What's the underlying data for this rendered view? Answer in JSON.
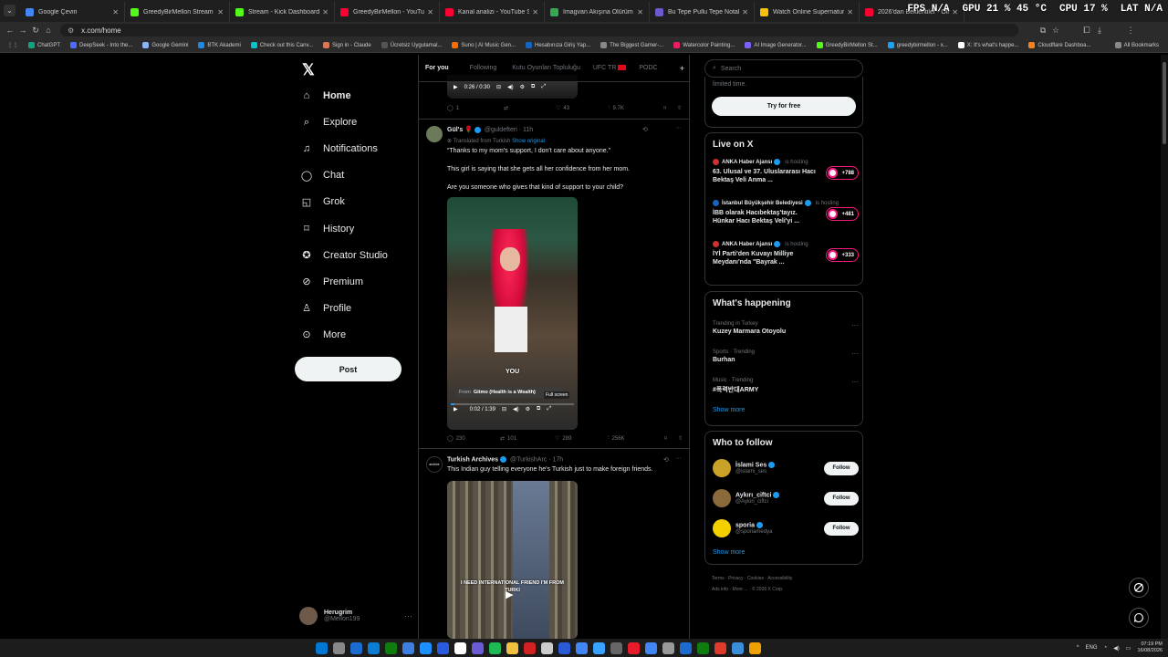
{
  "browser": {
    "tabs": [
      {
        "title": "Google Çeviri",
        "color": "#4285f4"
      },
      {
        "title": "GreedyBirMellon Stream - Wo",
        "color": "#53fc18"
      },
      {
        "title": "Stream - Kick Dashboard",
        "color": "#53fc18"
      },
      {
        "title": "GreedyBirMellon - YouTube",
        "color": "#ff0033"
      },
      {
        "title": "Kanal analizi - YouTube Studio",
        "color": "#ff0033"
      },
      {
        "title": "İmagvan Akışına Ölürüm Tü",
        "color": "#34a853"
      },
      {
        "title": "Bu Tepe Pullu Tepe Notaları |",
        "color": "#6a5acd"
      },
      {
        "title": "Watch Online Supernatural Se",
        "color": "#f4c20d"
      },
      {
        "title": "2026'dan Beklentiler - Olmaz",
        "color": "#ff0033"
      }
    ],
    "hud": {
      "fps": "FPS N/A",
      "gpu": "GPU 21 % 45 °C",
      "cpu": "CPU 17 %",
      "lat": "LAT N/A"
    },
    "url": "x.com/home",
    "bookmarks": [
      "ChatGPT",
      "DeepSeek - Into the...",
      "Google Gemini",
      "BTK Akademi",
      "Check out this Canv...",
      "Sign in - Claude",
      "Ücretsiz Uygulamal...",
      "Suno | AI Music Gen...",
      "Hesabınıza Giriş Yap...",
      "The Biggest Gamer-...",
      "Watercolor Painting...",
      "AI Image Generator...",
      "GreedyBirMellon St...",
      "greedybirmellon - x...",
      "X: It's what's happe...",
      "Cloudflare Dashboa..."
    ],
    "all_bookmarks": "All Bookmarks"
  },
  "nav": {
    "items": [
      {
        "label": "Home",
        "icon": "home-icon"
      },
      {
        "label": "Explore",
        "icon": "search-icon"
      },
      {
        "label": "Notifications",
        "icon": "bell-icon"
      },
      {
        "label": "Chat",
        "icon": "chat-icon"
      },
      {
        "label": "Grok",
        "icon": "grok-icon"
      },
      {
        "label": "History",
        "icon": "bookmark-icon"
      },
      {
        "label": "Creator Studio",
        "icon": "creator-icon"
      },
      {
        "label": "Premium",
        "icon": "premium-icon"
      },
      {
        "label": "Profile",
        "icon": "user-icon"
      },
      {
        "label": "More",
        "icon": "more-icon"
      }
    ],
    "post": "Post",
    "account": {
      "name": "Herugrim",
      "handle": "@Mellon199"
    }
  },
  "timeline": {
    "tabs": [
      "For you",
      "Following",
      "Kutu Oyunları Topluluğu",
      "UFC TR",
      "PODC"
    ],
    "top_post": {
      "time": "0:26 / 0:30",
      "replies": "1",
      "reposts": "",
      "likes": "43",
      "views": "9.7K"
    },
    "post1": {
      "name": "Gül's",
      "handle": "@guldefteri",
      "ago": "· 11h",
      "translated": "Translated from Turkish",
      "show_original": "Show original",
      "lines": [
        "“Thanks to my mom's support, I don't care about anyone.”",
        "This girl is saying that she gets all her confidence from her mom.",
        "Are you someone who gives that kind of support to your child?"
      ],
      "caption": "YOU",
      "from": "From",
      "source": "Gitmo (Health is a Wealth)",
      "tooltip": "Full screen",
      "time": "0:02 / 1:39",
      "replies": "230",
      "reposts": "101",
      "likes": "289",
      "views": "256K"
    },
    "post2": {
      "name": "Turkish Archives",
      "handle": "@TurkishArc",
      "ago": "· 17h",
      "avatar_text": "archive",
      "text": "This Indian guy telling everyone he's Turkish just to make foreign friends.",
      "caption": "I NEED INTERNATIONAL FRIEND I'M FROM TURKI"
    }
  },
  "right": {
    "search": "Search",
    "promo": {
      "text": "limited time.",
      "button": "Try for free"
    },
    "live": {
      "title": "Live on X",
      "hosting": "is hosting",
      "items": [
        {
          "host": "ANKA Haber Ajansı",
          "text": "63. Ulusal ve 37. Uluslararası Hacı Bektaş Veli Anma ...",
          "count": "+788"
        },
        {
          "host": "İstanbul Büyükşehir Belediyesi",
          "text": "İBB olarak Hacıbektaş'tayız. Hünkar Hacı Bektaş Veli'yi ...",
          "count": "+481"
        },
        {
          "host": "ANKA Haber Ajansı",
          "text": "İYİ Parti'den Kuvayı Milliye Meydanı'nda \"Bayrak ...",
          "count": "+333"
        }
      ]
    },
    "happening": {
      "title": "What's happening",
      "items": [
        {
          "context": "Trending in Turkey",
          "name": "Kuzey Marmara Otoyolu"
        },
        {
          "context": "Sports · Trending",
          "name": "Burhan"
        },
        {
          "context": "Music · Trending",
          "name": "#폭력반대ARMY"
        }
      ],
      "show_more": "Show more"
    },
    "follow": {
      "title": "Who to follow",
      "items": [
        {
          "name": "İslami Ses",
          "handle": "@islami_ses",
          "btn": "Follow",
          "color": "#c9a227"
        },
        {
          "name": "Aykırı_ciftci",
          "handle": "@Aykiri_ciftci",
          "btn": "Follow",
          "color": "#8a6a3a"
        },
        {
          "name": "sporia",
          "handle": "@sporiamedya",
          "btn": "Follow",
          "color": "#f5d000"
        }
      ],
      "show_more": "Show more"
    },
    "footer": [
      "Terms",
      "Privacy",
      "Cookies",
      "Accessibility",
      "Ads info",
      "More ...",
      "© 2026 X Corp."
    ]
  },
  "taskbar": {
    "lang": "ENG",
    "time": "07:19 PM",
    "date": "16/08/2026"
  }
}
